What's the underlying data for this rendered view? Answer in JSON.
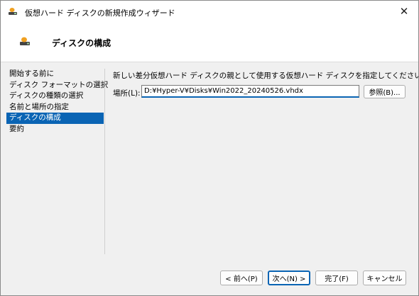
{
  "window": {
    "title": "仮想ハード ディスクの新規作成ウィザード",
    "close_glyph": "✕"
  },
  "header": {
    "title": "ディスクの構成"
  },
  "nav": {
    "items": [
      {
        "label": "開始する前に"
      },
      {
        "label": "ディスク フォーマットの選択"
      },
      {
        "label": "ディスクの種類の選択"
      },
      {
        "label": "名前と場所の指定"
      },
      {
        "label": "ディスクの構成"
      },
      {
        "label": "要約"
      }
    ],
    "active_index": 4
  },
  "main": {
    "instruction": "新しい差分仮想ハード ディスクの親として使用する仮想ハード ディスクを指定してください。",
    "location_label": "場所(L):",
    "location_value": "D:¥Hyper-V¥Disks¥Win2022_20240526.vhdx",
    "browse_label": "参照(B)..."
  },
  "footer": {
    "back_label": "< 前へ(P)",
    "next_label": "次へ(N) >",
    "finish_label": "完了(F)",
    "cancel_label": "キャンセル"
  },
  "colors": {
    "accent": "#0a64b4",
    "window_bg": "#f0f0f0",
    "header_bg": "#ffffff"
  },
  "icons": {
    "app": "virtual-disk-icon",
    "header": "virtual-disk-icon",
    "close": "close-icon"
  }
}
